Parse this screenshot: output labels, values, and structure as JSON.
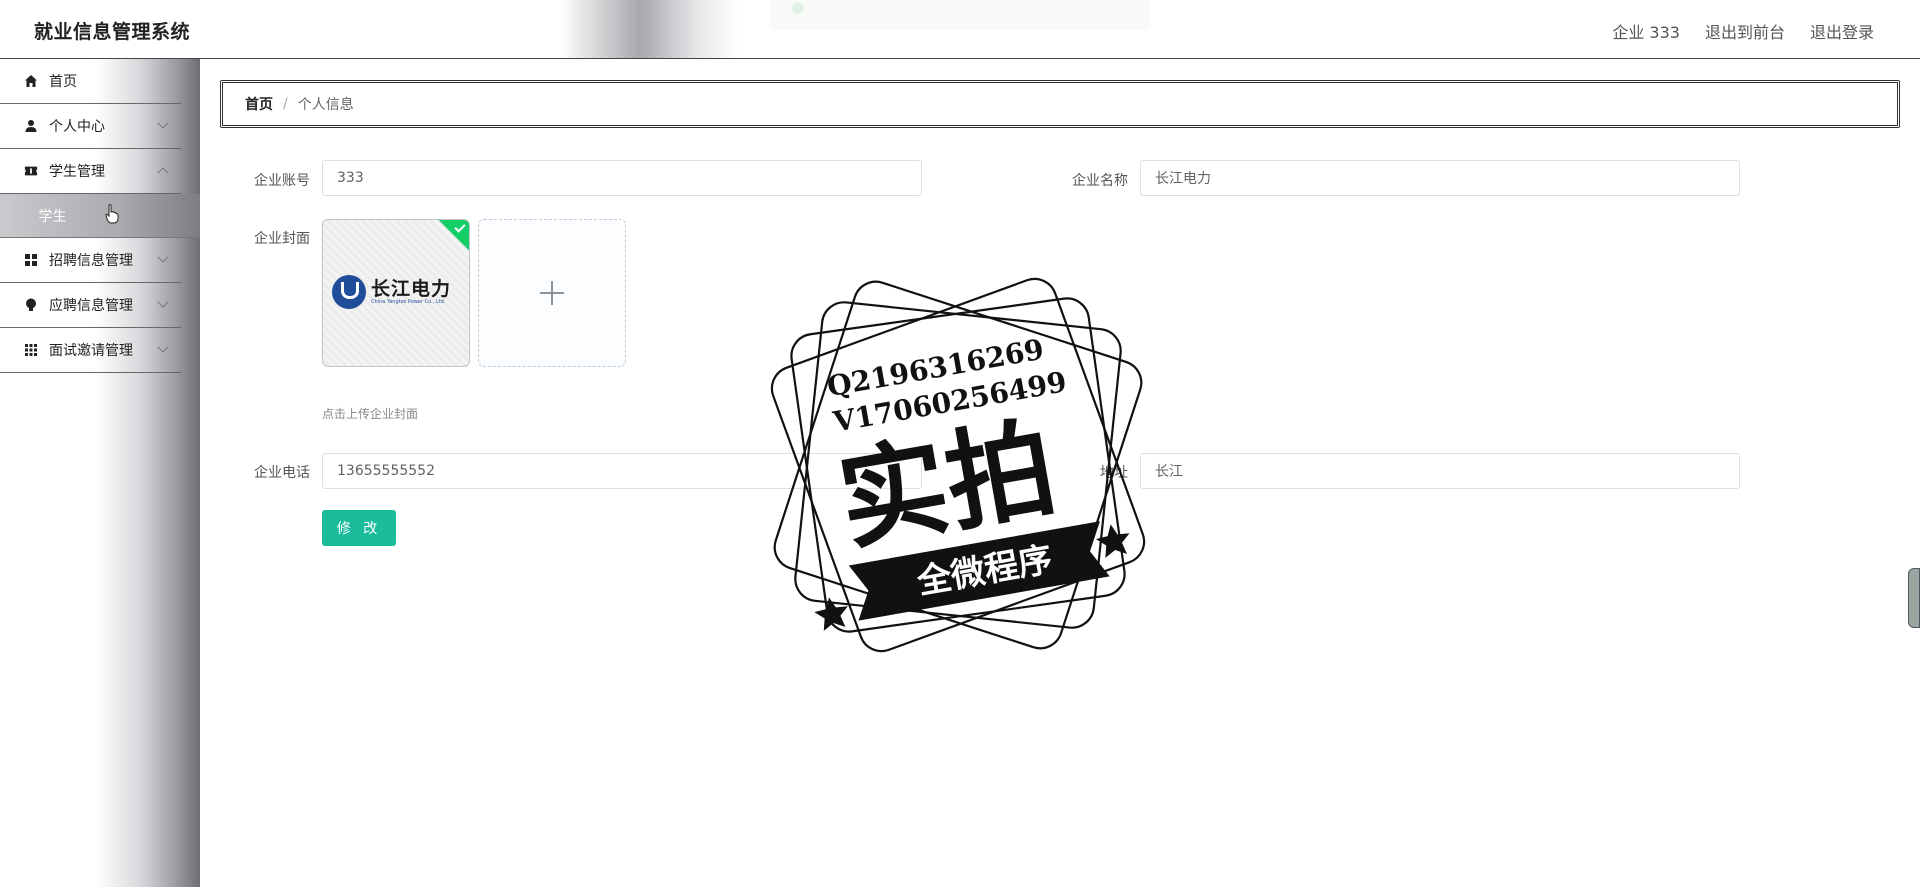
{
  "header": {
    "app_title": "就业信息管理系统",
    "user_label": "企业 333",
    "to_frontend": "退出到前台",
    "logout": "退出登录"
  },
  "sidebar": {
    "items": [
      {
        "label": "首页",
        "icon": "home-icon"
      },
      {
        "label": "个人中心",
        "icon": "user-icon"
      },
      {
        "label": "学生管理",
        "icon": "ticket-icon"
      },
      {
        "label": "招聘信息管理",
        "icon": "grid-icon"
      },
      {
        "label": "应聘信息管理",
        "icon": "bulb-icon"
      },
      {
        "label": "面试邀请管理",
        "icon": "apps-icon"
      }
    ],
    "sub_item": "学生"
  },
  "breadcrumb": {
    "home": "首页",
    "separator": "/",
    "current": "个人信息"
  },
  "form": {
    "account_label": "企业账号",
    "account_value": "333",
    "name_label": "企业名称",
    "name_value": "长江电力",
    "cover_label": "企业封面",
    "cover_logo_cn": "长江电力",
    "cover_logo_en": "China Yangtze Power Co., Ltd.",
    "upload_tip": "点击上传企业封面",
    "phone_label": "企业电话",
    "phone_value": "13655555552",
    "address_label": "地址",
    "address_value": "长江",
    "submit_label": "修 改"
  },
  "watermark": {
    "line1": "Q2196316269",
    "line2": "V17060256499",
    "main": "实拍",
    "banner": "全微程序"
  },
  "colors": {
    "primary_button": "#1abc9c",
    "upload_success": "#13ce66"
  }
}
